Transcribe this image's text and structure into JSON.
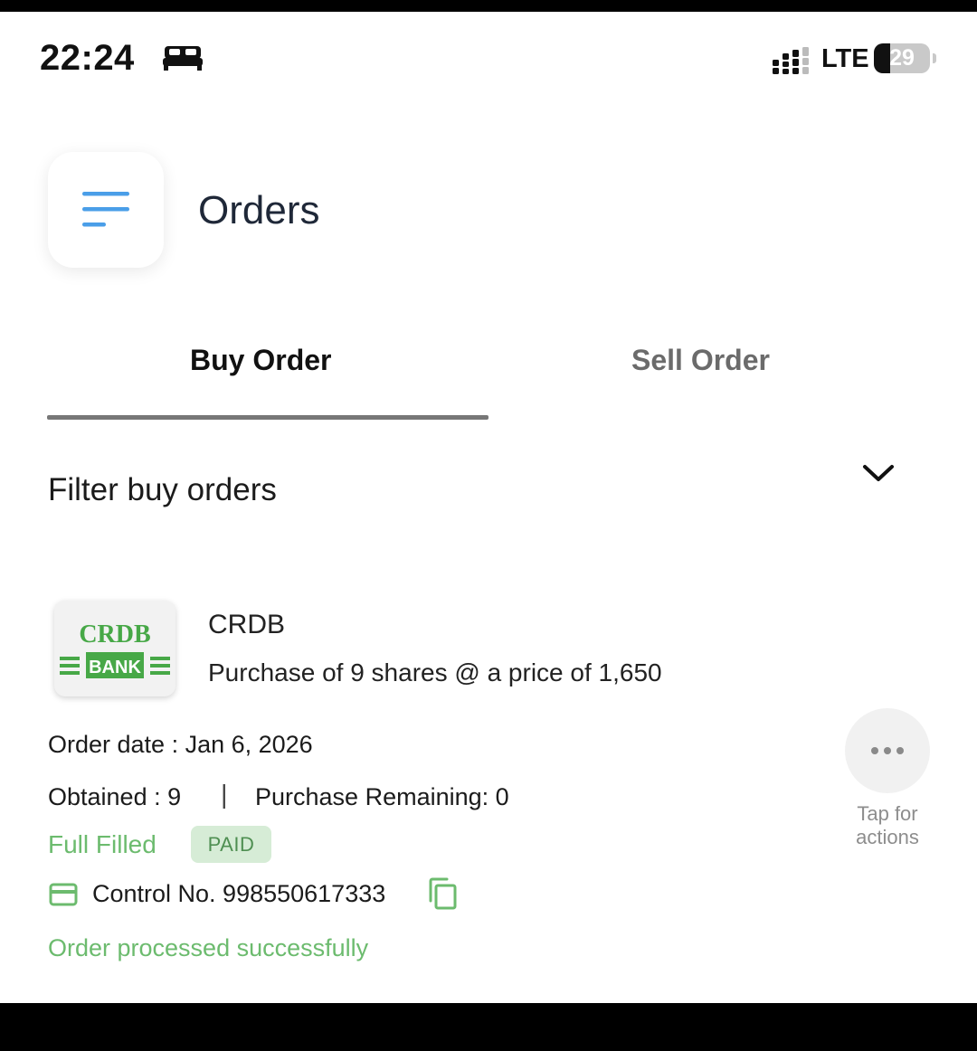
{
  "status_bar": {
    "time": "22:24",
    "network": "LTE",
    "battery_percent": "29",
    "battery_level": 0.29,
    "icons": [
      "bed-icon",
      "signal-icon",
      "battery-icon"
    ]
  },
  "header": {
    "title": "Orders",
    "menu_icon": "menu-icon",
    "accent_color": "#4a9ee8"
  },
  "tabs": [
    {
      "label": "Buy Order",
      "active": true
    },
    {
      "label": "Sell Order",
      "active": false
    }
  ],
  "filter": {
    "label": "Filter buy orders",
    "icon": "chevron-down-icon"
  },
  "order": {
    "logo": {
      "top_text": "CRDB",
      "bottom_text": "BANK",
      "color": "#47a847"
    },
    "company": "CRDB",
    "description": "Purchase of 9 shares @ a price of 1,650",
    "order_date": "Order date : Jan 6, 2026",
    "obtained": "Obtained : 9",
    "separator": "|",
    "remaining": "Purchase Remaining: 0",
    "status": "Full Filled",
    "badge": "PAID",
    "control_no": "Control No. 998550617333",
    "message": "Order processed successfully",
    "status_color": "#6cbb6e",
    "actions_label": "Tap for actions"
  }
}
